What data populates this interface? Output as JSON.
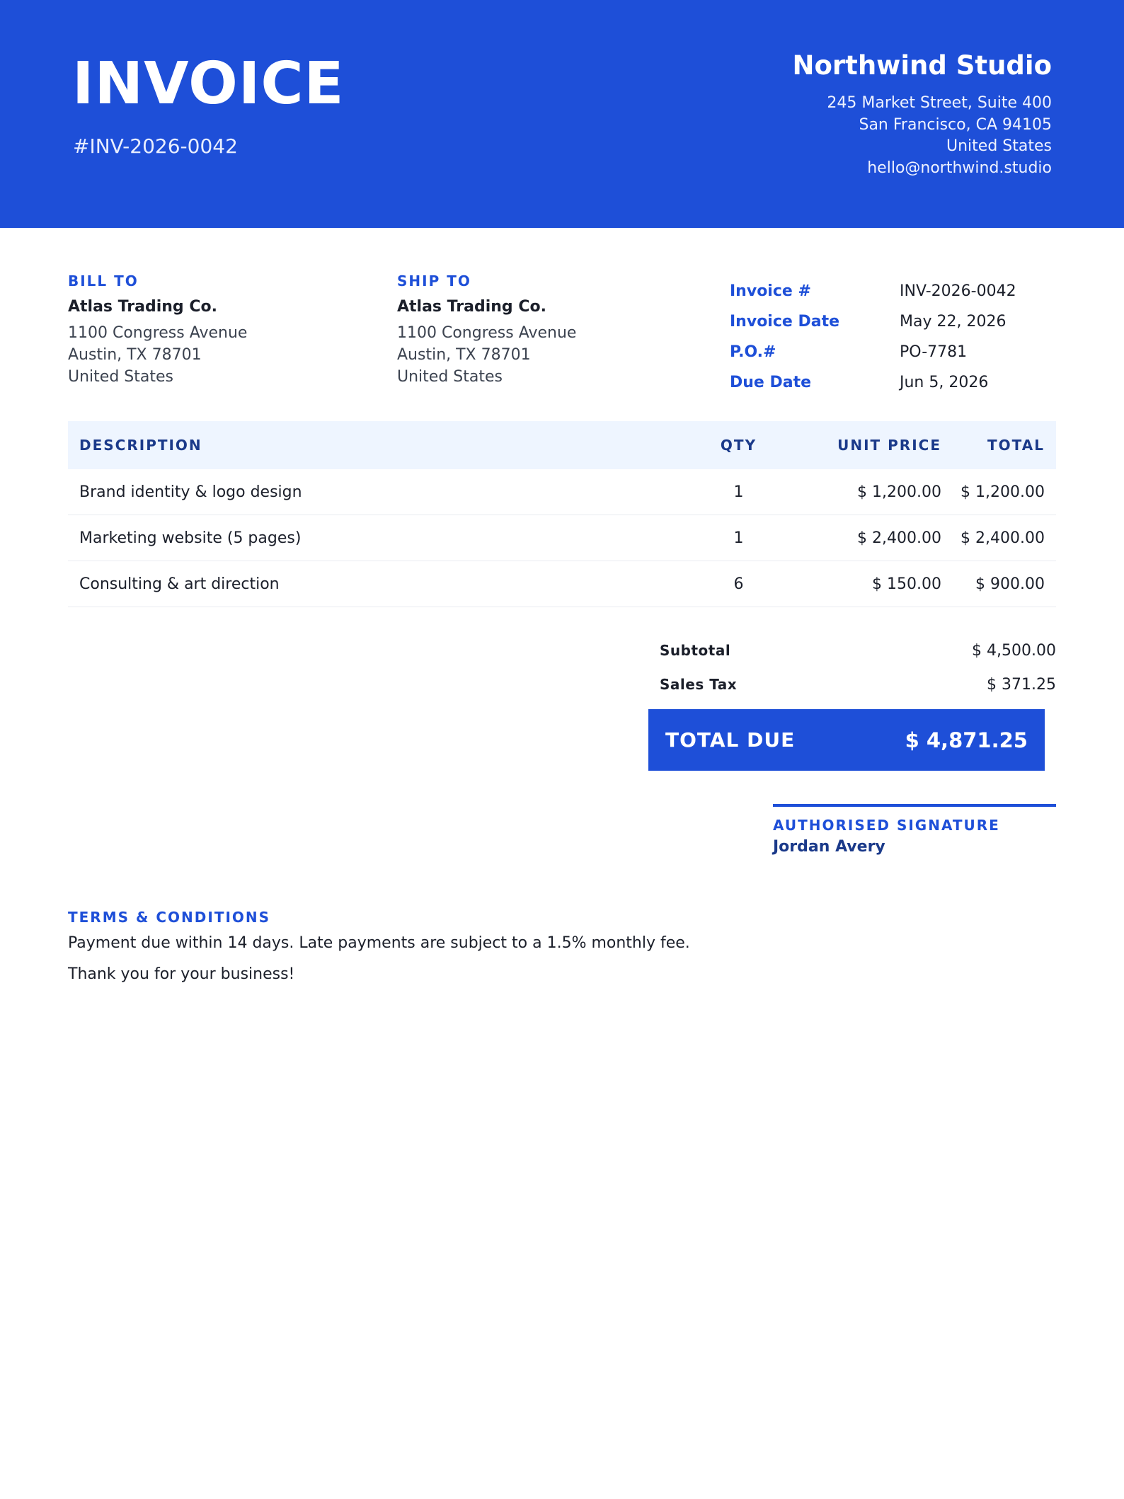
{
  "header": {
    "title": "INVOICE",
    "number": "#INV-2026-0042",
    "company": {
      "name": "Northwind Studio",
      "lines": [
        "245 Market Street, Suite 400",
        "San Francisco, CA 94105",
        "United States",
        "hello@northwind.studio"
      ]
    }
  },
  "bill_to": {
    "label": "BILL TO",
    "name": "Atlas Trading Co.",
    "lines": [
      "1100 Congress Avenue",
      "Austin, TX 78701",
      "United States"
    ]
  },
  "ship_to": {
    "label": "SHIP TO",
    "name": "Atlas Trading Co.",
    "lines": [
      "1100 Congress Avenue",
      "Austin, TX 78701",
      "United States"
    ]
  },
  "meta": [
    {
      "label": "Invoice #",
      "value": "INV-2026-0042"
    },
    {
      "label": "Invoice Date",
      "value": "May 22, 2026"
    },
    {
      "label": "P.O.#",
      "value": "PO-7781"
    },
    {
      "label": "Due Date",
      "value": "Jun 5, 2026"
    }
  ],
  "items": {
    "headers": {
      "description": "DESCRIPTION",
      "qty": "QTY",
      "unit_price": "UNIT PRICE",
      "total": "TOTAL"
    },
    "rows": [
      {
        "description": "Brand identity & logo design",
        "qty": "1",
        "unit_price": "$ 1,200.00",
        "total": "$ 1,200.00"
      },
      {
        "description": "Marketing website (5 pages)",
        "qty": "1",
        "unit_price": "$ 2,400.00",
        "total": "$ 2,400.00"
      },
      {
        "description": "Consulting & art direction",
        "qty": "6",
        "unit_price": "$ 150.00",
        "total": "$ 900.00"
      }
    ]
  },
  "totals": {
    "subtotal_label": "Subtotal",
    "subtotal_value": "$ 4,500.00",
    "tax_label": "Sales Tax",
    "tax_value": "$ 371.25",
    "due_label": "TOTAL DUE",
    "due_value": "$ 4,871.25"
  },
  "signature": {
    "label": "AUTHORISED SIGNATURE",
    "name": "Jordan Avery"
  },
  "terms": {
    "label": "TERMS & CONDITIONS",
    "text": "Payment due within 14 days. Late payments are subject to a 1.5% monthly fee.",
    "thanks": "Thank you for your business!"
  },
  "colors": {
    "accent": "#1e4fd8",
    "header_row_bg": "#eef5ff",
    "dark_text": "#1b1f2a"
  }
}
